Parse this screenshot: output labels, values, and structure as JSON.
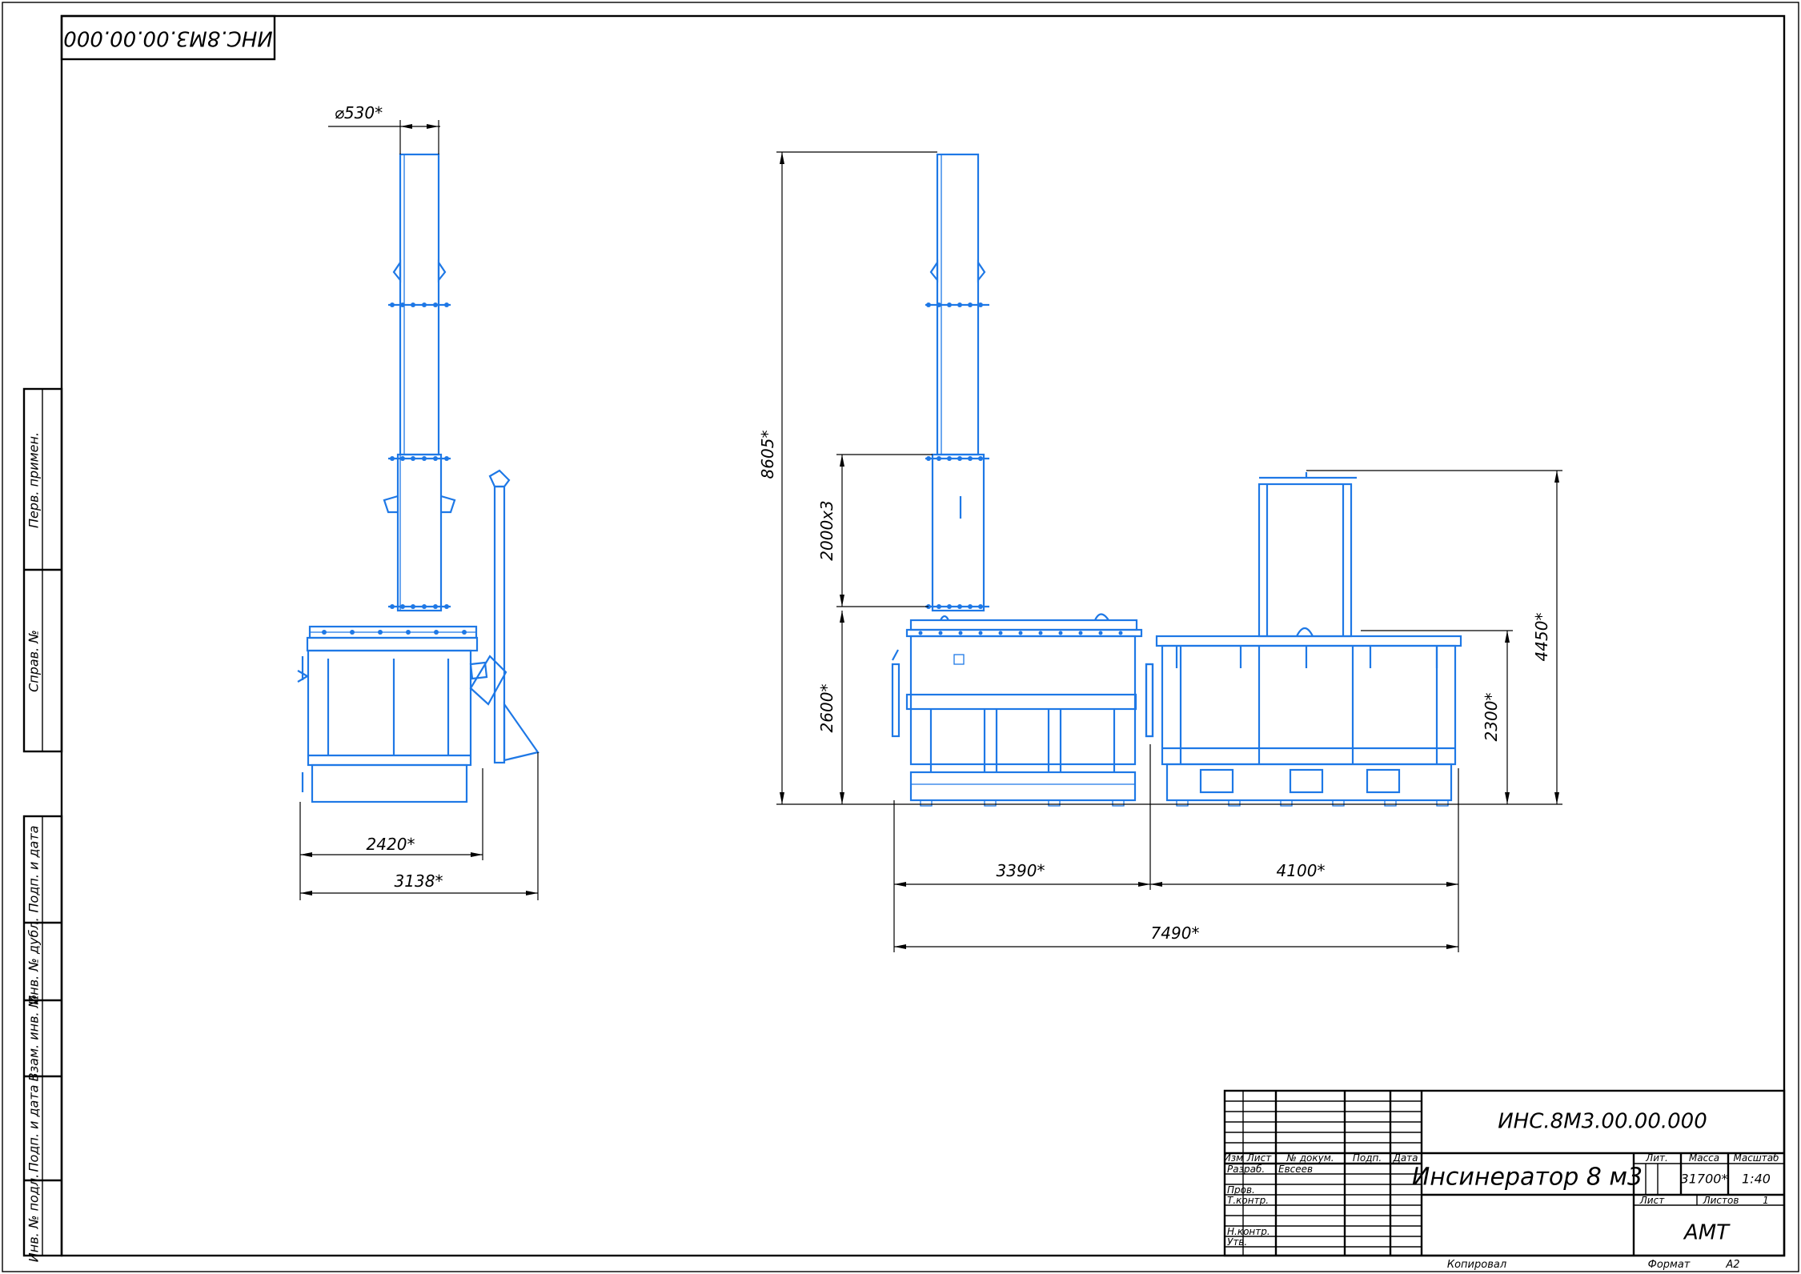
{
  "stamp_top": "ИНС.8М3.00.00.000",
  "side_labels": [
    "Перв. примен.",
    "Справ. №",
    "Подп. и дата",
    "Инв. № дубл.",
    "Взам. инв. №",
    "Подп. и дата",
    "Инв. № подл."
  ],
  "dimensions": {
    "chimney_diameter": "⌀530*",
    "left_width_1": "2420*",
    "left_width_2": "3138*",
    "total_height": "8605*",
    "chimney_sections": "2000х3",
    "body_height": "2600*",
    "right_height_1": "2300*",
    "right_height_2": "4450*",
    "width_a": "3390*",
    "width_b": "4100*",
    "width_total": "7490*"
  },
  "title_block": {
    "designation": "ИНС.8М3.00.00.000",
    "name": "Инсинератор 8 м3",
    "headers": [
      "Изм",
      "Лист",
      "№ докум.",
      "Подп.",
      "Дата"
    ],
    "rows": [
      "Разраб.",
      "Пров.",
      "Т.контр.",
      "Н.контр.",
      "Утв."
    ],
    "developer": "Евсеев",
    "lit_label": "Лит.",
    "mass_label": "Масса",
    "scale_label": "Масштаб",
    "mass": "31700*",
    "scale": "1:40",
    "sheet_label": "Лист",
    "sheets_label": "Листов",
    "sheets": "1",
    "org": "АМТ",
    "copied": "Копировал",
    "format_label": "Формат",
    "format": "А2"
  }
}
